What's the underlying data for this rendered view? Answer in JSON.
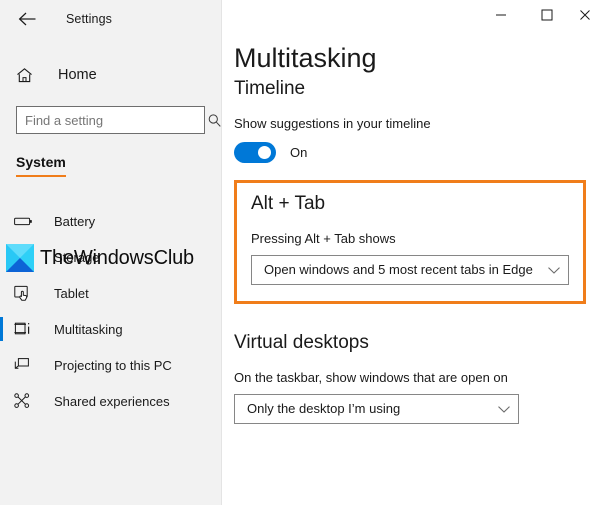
{
  "window": {
    "app_title": "Settings",
    "back_icon": "back-arrow-icon",
    "minimize_label": "—",
    "maximize_label": "□",
    "close_label": "✕"
  },
  "sidebar": {
    "home_label": "Home",
    "home_icon": "home-icon",
    "search": {
      "placeholder": "Find a setting",
      "value": "",
      "icon": "search-icon"
    },
    "section_label": "System",
    "items": [
      {
        "label": "Battery",
        "icon": "battery-icon",
        "selected": false
      },
      {
        "label": "Storage",
        "icon": "storage-icon",
        "selected": false
      },
      {
        "label": "Tablet",
        "icon": "tablet-icon",
        "selected": false
      },
      {
        "label": "Multitasking",
        "icon": "multitasking-icon",
        "selected": true
      },
      {
        "label": "Projecting to this PC",
        "icon": "projecting-icon",
        "selected": false
      },
      {
        "label": "Shared experiences",
        "icon": "shared-experiences-icon",
        "selected": false
      }
    ]
  },
  "watermark": {
    "text": "TheWindowsClub",
    "logo_icon": "thewindowsclub-logo-icon"
  },
  "main": {
    "page_title": "Multitasking",
    "timeline": {
      "heading": "Timeline",
      "setting_label": "Show suggestions in your timeline",
      "toggle_state": "On"
    },
    "alt_tab": {
      "heading": "Alt + Tab",
      "setting_label": "Pressing Alt + Tab shows",
      "dropdown_value": "Open windows and 5 most recent tabs in Edge",
      "dropdown_icon": "chevron-down-icon"
    },
    "virtual_desktops": {
      "heading": "Virtual desktops",
      "setting_label": "On the taskbar, show windows that are open on",
      "dropdown_value": "Only the desktop I’m using",
      "dropdown_icon": "chevron-down-icon"
    }
  },
  "colors": {
    "accent_blue": "#0078d7",
    "highlight_orange": "#f07d1a",
    "sidebar_bg": "#f2f2f2",
    "logo_cyan": "#29c8f5",
    "logo_blue": "#0d63d6"
  }
}
